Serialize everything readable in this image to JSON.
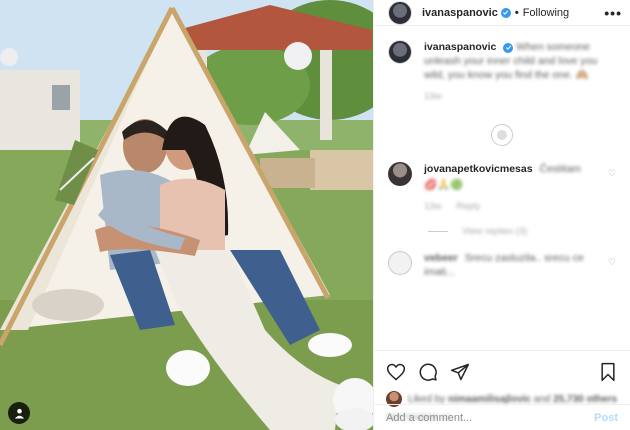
{
  "header": {
    "username": "ivanaspanovic",
    "separator": "•",
    "follow_status": "Following",
    "more_icon": "more-horizontal-icon"
  },
  "caption": {
    "username": "ivanaspanovic",
    "text": "When someone unleash your inner child and love you wild, you know you find the one.",
    "time": "13w"
  },
  "comments": [
    {
      "username": "jovanapetkovicmesas",
      "text": "Čestitam",
      "time": "13w",
      "reply_label": "Reply",
      "view_replies": "View replies (3)"
    },
    {
      "username": "vebeer",
      "text": "Srecu zasluzila.. srecu ce imati..."
    }
  ],
  "actions": {
    "like_icon": "heart-icon",
    "comment_icon": "comment-icon",
    "share_icon": "send-icon",
    "save_icon": "bookmark-icon"
  },
  "likes": {
    "prefix": "Liked by",
    "liked_by": "nimaamilisajlovic",
    "middle": "and",
    "others": "25,730 others"
  },
  "date": "September 12",
  "add_comment": {
    "placeholder": "Add a comment...",
    "post_label": "Post"
  },
  "colors": {
    "accent": "#3897f0",
    "post_disabled": "#b3dbff",
    "muted": "#8e8e8e"
  }
}
